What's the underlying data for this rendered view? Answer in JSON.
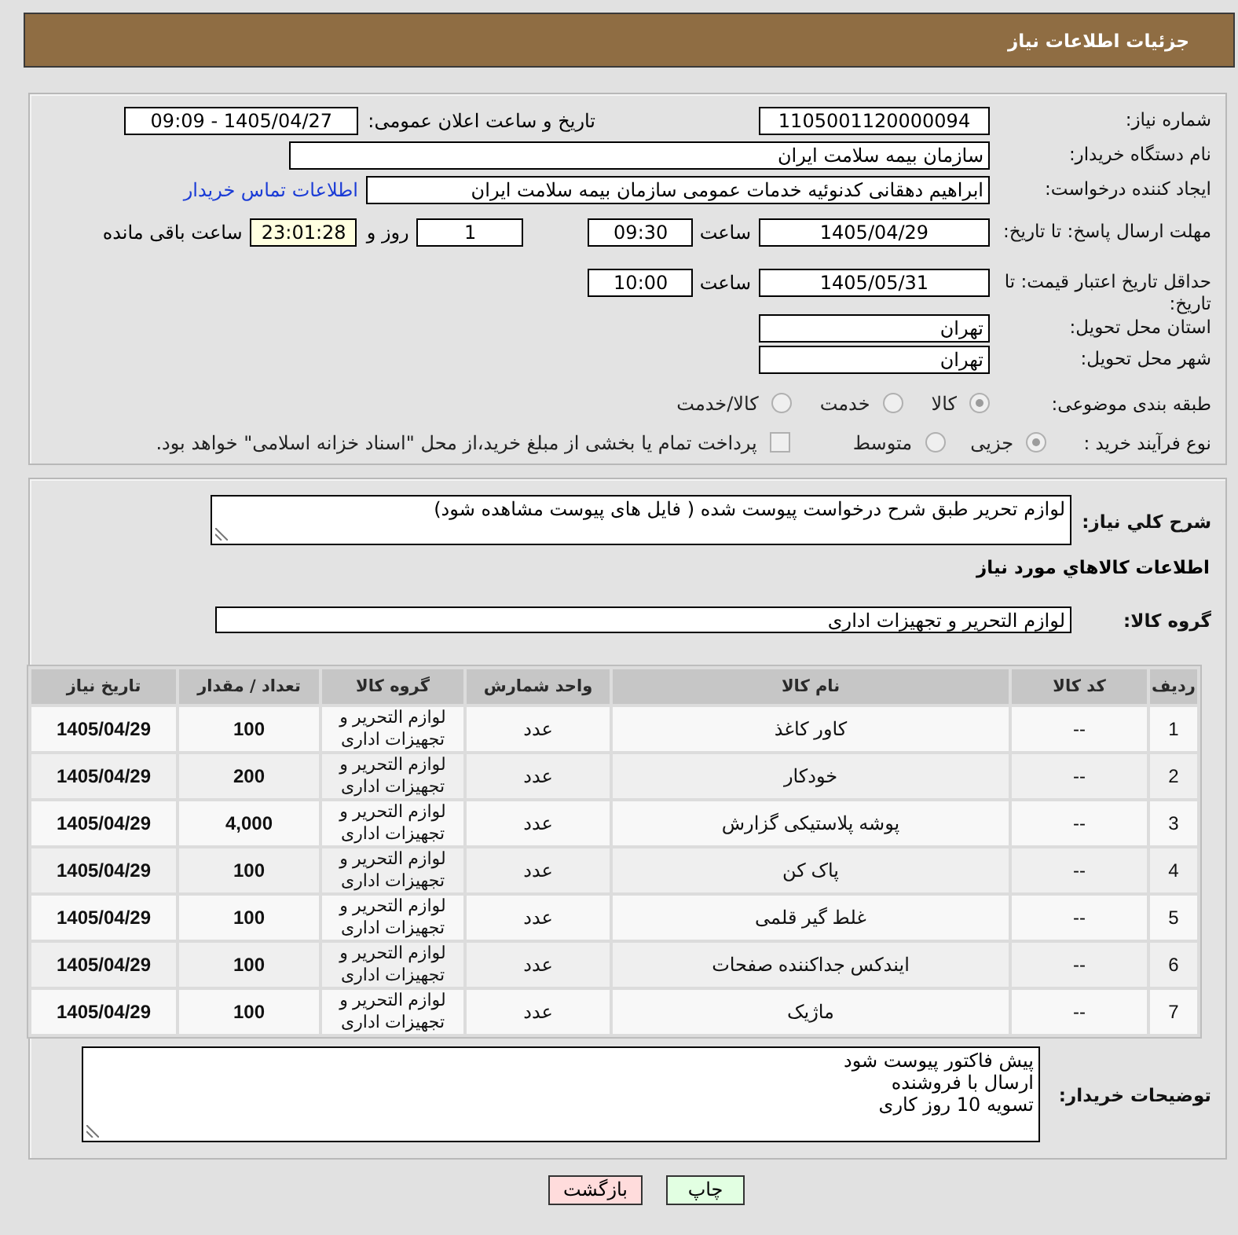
{
  "header": {
    "title": "جزئیات اطلاعات نیاز"
  },
  "details": {
    "need_number": {
      "label": "شماره نیاز:",
      "value": "1105001120000094"
    },
    "announce_datetime": {
      "label": "تاریخ و ساعت اعلان عمومی:",
      "value": "1405/04/27 - 09:09"
    },
    "buyer_org": {
      "label": "نام دستگاه خریدار:",
      "value": "سازمان بیمه سلامت ایران"
    },
    "requester": {
      "label": "ایجاد کننده درخواست:",
      "value": "ابراهیم دهقانی کدنوئیه خدمات عمومی سازمان بیمه سلامت ایران",
      "link": "اطلاعات تماس خریدار"
    },
    "response_deadline": {
      "label": "مهلت ارسال پاسخ: تا تاریخ:",
      "date": "1405/04/29",
      "time_label": "ساعت",
      "time": "09:30",
      "days": "1",
      "days_label": "روز و",
      "remaining": "23:01:28",
      "remaining_label": "ساعت باقی مانده"
    },
    "price_validity": {
      "label": "حداقل تاریخ اعتبار قیمت: تا تاریخ:",
      "date": "1405/05/31",
      "time_label": "ساعت",
      "time": "10:00"
    },
    "delivery_province": {
      "label": "استان محل تحویل:",
      "value": "تهران"
    },
    "delivery_city": {
      "label": "شهر محل تحویل:",
      "value": "تهران"
    },
    "category": {
      "label": "طبقه بندی موضوعی:",
      "options": [
        {
          "label": "کالا",
          "selected": true
        },
        {
          "label": "خدمت",
          "selected": false
        },
        {
          "label": "کالا/خدمت",
          "selected": false
        }
      ]
    },
    "purchase_process": {
      "label": "نوع فرآیند خرید :",
      "options": [
        {
          "label": "جزیی",
          "selected": true
        },
        {
          "label": "متوسط",
          "selected": false
        }
      ],
      "treasury": {
        "label": "پرداخت تمام یا بخشی از مبلغ خرید،از محل \"اسناد خزانه اسلامی\" خواهد بود.",
        "checked": false
      }
    }
  },
  "description": {
    "label": "شرح کلي نیاز:",
    "value": "لوازم تحریر طبق شرح درخواست پیوست شده ( فایل های پیوست مشاهده شود)"
  },
  "goods_section": {
    "title": "اطلاعات کالاهاي مورد نیاز"
  },
  "goods_group": {
    "label": "گروه کالا:",
    "value": "لوازم التحریر و تجهیزات اداری"
  },
  "items_table": {
    "columns": [
      "ردیف",
      "کد کالا",
      "نام کالا",
      "واحد شمارش",
      "گروه کالا",
      "تعداد / مقدار",
      "تاریخ نیاز"
    ],
    "rows": [
      [
        "1",
        "--",
        "کاور کاغذ",
        "عدد",
        "لوازم التحریر و تجهیزات اداری",
        "100",
        "1405/04/29"
      ],
      [
        "2",
        "--",
        "خودکار",
        "عدد",
        "لوازم التحریر و تجهیزات اداری",
        "200",
        "1405/04/29"
      ],
      [
        "3",
        "--",
        "پوشه پلاستیکی گزارش",
        "عدد",
        "لوازم التحریر و تجهیزات اداری",
        "4,000",
        "1405/04/29"
      ],
      [
        "4",
        "--",
        "پاک کن",
        "عدد",
        "لوازم التحریر و تجهیزات اداری",
        "100",
        "1405/04/29"
      ],
      [
        "5",
        "--",
        "غلط گیر قلمی",
        "عدد",
        "لوازم التحریر و تجهیزات اداری",
        "100",
        "1405/04/29"
      ],
      [
        "6",
        "--",
        "ایندکس جداکننده صفحات",
        "عدد",
        "لوازم التحریر و تجهیزات اداری",
        "100",
        "1405/04/29"
      ],
      [
        "7",
        "--",
        "ماژیک",
        "عدد",
        "لوازم التحریر و تجهیزات اداری",
        "100",
        "1405/04/29"
      ]
    ]
  },
  "buyer_notes": {
    "label": "توضیحات خریدار:",
    "lines": [
      "پیش فاکتور پیوست شود",
      "ارسال با فروشنده",
      "تسویه 10 روز کاری"
    ]
  },
  "buttons": [
    {
      "label": "چاپ",
      "kind": "print"
    },
    {
      "label": "بازگشت",
      "kind": "back"
    }
  ]
}
